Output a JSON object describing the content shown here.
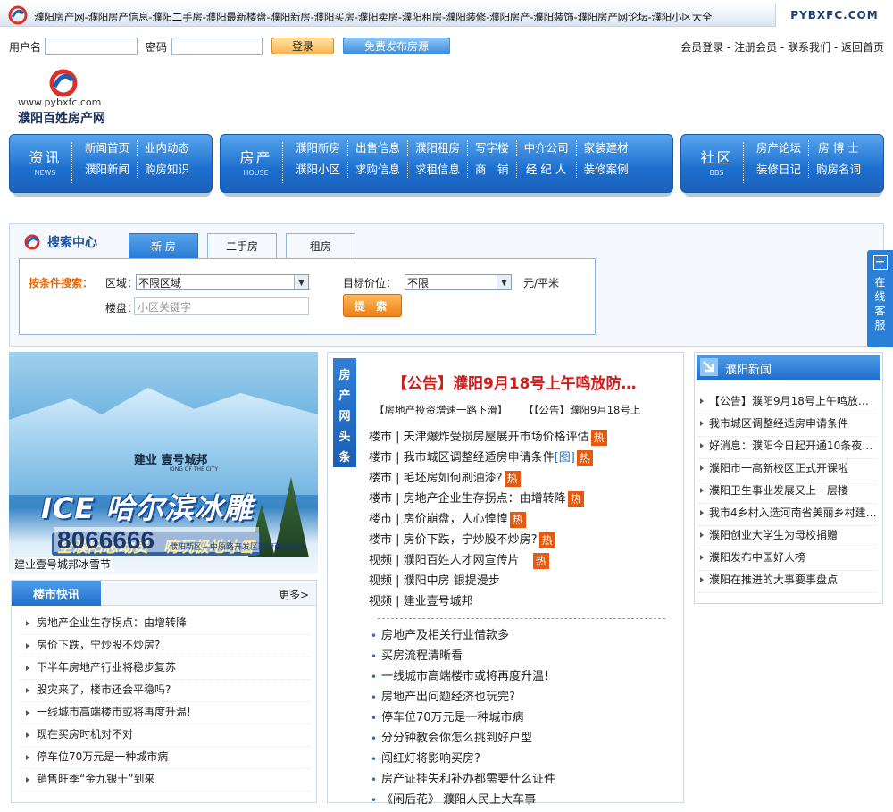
{
  "topbar": {
    "links": "濮阳房产网-濮阳房产信息-濮阳二手房-濮阳最新楼盘-濮阳新房-濮阳买房-濮阳卖房-濮阳租房-濮阳装修-濮阳房产-濮阳装饰-濮阳房产网论坛-濮阳小区大全",
    "domain": "PYBXFC.COM"
  },
  "login": {
    "username_label": "用户名",
    "password_label": "密码",
    "login_button": "登录",
    "publish_button": "免费发布房源",
    "right_links": "会员登录 - 注册会员 - 联系我们 - 返回首页"
  },
  "logo": {
    "url": "www.pybxfc.com",
    "name": "濮阳百姓房产网"
  },
  "nav": {
    "news": {
      "cn": "资讯",
      "en": "NEWS",
      "items": [
        "新闻首页",
        "业内动态",
        "濮阳新闻",
        "购房知识"
      ]
    },
    "house": {
      "cn": "房产",
      "en": "HOUSE",
      "items": [
        "濮阳新房",
        "出售信息",
        "濮阳租房",
        "写字楼",
        "中介公司",
        "家装建材",
        "濮阳小区",
        "求购信息",
        "求租信息",
        "商　铺",
        "经 纪 人",
        "装修案例"
      ]
    },
    "bbs": {
      "cn": "社区",
      "en": "BBS",
      "items": [
        "房产论坛",
        "房 博 士",
        "装修日记",
        "购房名词"
      ]
    }
  },
  "search": {
    "title": "搜索中心",
    "tabs": [
      "新 房",
      "二手房",
      "租房"
    ],
    "condition_label": "按条件搜索：",
    "area_label": "区域：",
    "area_value": "不限区域",
    "price_label": "目标价位：",
    "price_value": "不限",
    "unit": "元/平米",
    "building_label": "楼盘：",
    "keyword_placeholder": "小区关键字",
    "submit": "提 索"
  },
  "online_service": "在线客服",
  "banner": {
    "developer": "建业 壹号城邦",
    "developer_en": "KING OF THE CITY",
    "headline": "ICE 哈尔滨冰雕",
    "slogan": "全濮阳总动员　嗨玩极地冰雪",
    "phone": "8066666",
    "address": "濮阳新区—中原路开发区政府西800米",
    "caption": "建业壹号城邦冰雪节"
  },
  "flash": {
    "title": "楼市快讯",
    "more": "更多>",
    "items": [
      "房地产企业生存拐点：由增转降",
      "房价下跌，宁炒股不炒房?",
      "下半年房地产行业将稳步复苏",
      "股灾来了，楼市还会平稳吗?",
      "一线城市高端楼市或将再度升温!",
      "现在买房时机对不对",
      "停车位70万元是一种城市病",
      "销售旺季“金九银十”到来"
    ]
  },
  "headnews": {
    "label": [
      "房",
      "产",
      "网",
      "头",
      "条"
    ],
    "big_title": "【公告】濮阳9月18号上午鸣放防…",
    "sub_left": "【房地产投资增速一路下滑】",
    "sub_right": "【【公告】濮阳9月18号上",
    "rows": [
      {
        "text": "楼市 | 天津爆炸受损房屋展开市场价格评估",
        "img": "",
        "hot": "热"
      },
      {
        "text": "楼市 | 我市城区调整经适房申请条件",
        "img": "[图]",
        "hot": "热"
      },
      {
        "text": "楼市 | 毛坯房如何刷油漆?",
        "img": "",
        "hot": "热"
      },
      {
        "text": "楼市 | 房地产企业生存拐点：由增转降",
        "img": "",
        "hot": "热"
      },
      {
        "text": "楼市 | 房价崩盘，人心惶惶",
        "img": "",
        "hot": "热"
      },
      {
        "text": "楼市 | 房价下跌，宁炒股不炒房?",
        "img": "",
        "hot": "热"
      },
      {
        "text": "视频 | 濮阳百姓人才网宣传片　",
        "img": "",
        "hot": "热"
      },
      {
        "text": "视频 | 濮阳中房 银提漫步",
        "img": "",
        "hot": ""
      },
      {
        "text": "视频 | 建业壹号城邦",
        "img": "",
        "hot": ""
      }
    ],
    "bullets": [
      "房地产及相关行业借款多",
      "买房流程清晰看",
      "一线城市高端楼市或将再度升温!",
      "房地产出问题经济也玩完?",
      "停车位70万元是一种城市病",
      "分分钟教会你怎么挑到好户型",
      "闯红灯将影响买房?",
      "房产证挂失和补办都需要什么证件",
      "《闲后花》 濮阳人民上大车事"
    ]
  },
  "pynews": {
    "title": "濮阳新闻",
    "items": [
      "【公告】濮阳9月18号上午鸣放…",
      "我市城区调整经适房申请条件",
      "好消息：濮阳今日起开通10条夜…",
      "濮阳市一高新校区正式开课啦",
      "濮阳卫生事业发展又上一层楼",
      "我市4乡村入选河南省美丽乡村建…",
      "濮阳创业大学生为母校捐赠",
      "濮阳发布中国好人榜",
      "濮阳在推进的大事要事盘点"
    ]
  },
  "colors": {
    "brand_blue": "#1d6fcf",
    "hot_orange": "#e8590c",
    "headline_red": "#d21b1b"
  }
}
